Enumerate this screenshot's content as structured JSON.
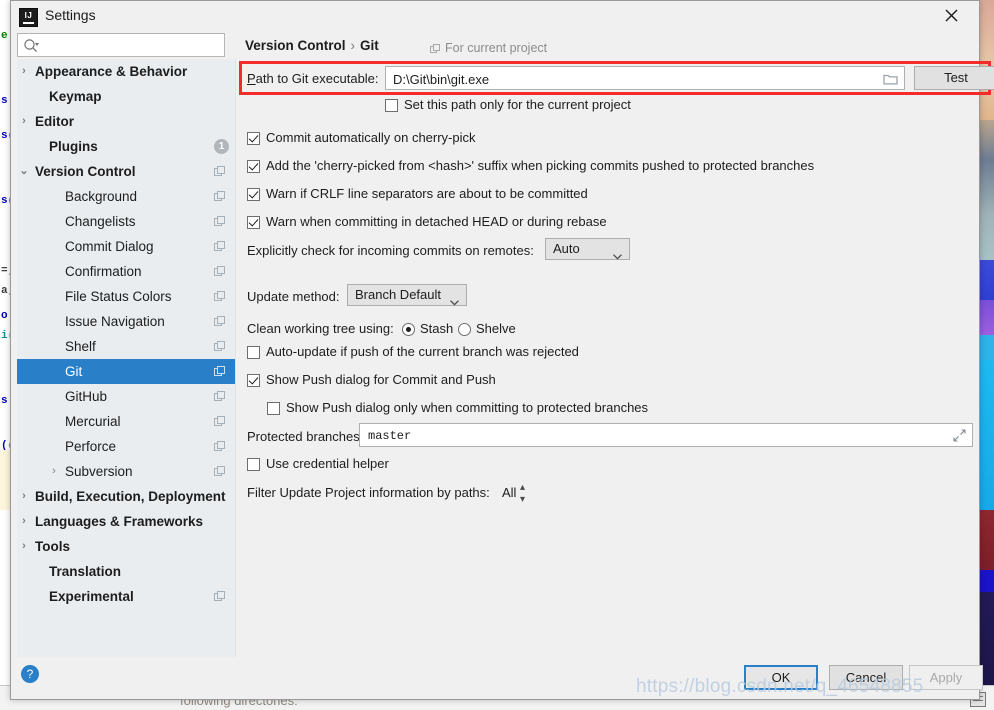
{
  "window": {
    "title": "Settings",
    "logo_text": "IJ",
    "close_icon": "close-icon"
  },
  "search": {
    "value": "",
    "placeholder": "",
    "icon": "search-icon"
  },
  "sidebar": {
    "items": [
      {
        "label": "Appearance & Behavior",
        "indent": 10,
        "twisty": "›",
        "bold": true,
        "copy": false,
        "badge": ""
      },
      {
        "label": "Keymap",
        "indent": 24,
        "twisty": "",
        "bold": true,
        "copy": false,
        "badge": ""
      },
      {
        "label": "Editor",
        "indent": 10,
        "twisty": "›",
        "bold": true,
        "copy": false,
        "badge": ""
      },
      {
        "label": "Plugins",
        "indent": 24,
        "twisty": "",
        "bold": true,
        "copy": false,
        "badge": "1"
      },
      {
        "label": "Version Control",
        "indent": 10,
        "twisty": "⌄",
        "bold": true,
        "copy": true,
        "badge": ""
      },
      {
        "label": "Background",
        "indent": 40,
        "twisty": "",
        "bold": false,
        "copy": true,
        "badge": ""
      },
      {
        "label": "Changelists",
        "indent": 40,
        "twisty": "",
        "bold": false,
        "copy": true,
        "badge": ""
      },
      {
        "label": "Commit Dialog",
        "indent": 40,
        "twisty": "",
        "bold": false,
        "copy": true,
        "badge": ""
      },
      {
        "label": "Confirmation",
        "indent": 40,
        "twisty": "",
        "bold": false,
        "copy": true,
        "badge": ""
      },
      {
        "label": "File Status Colors",
        "indent": 40,
        "twisty": "",
        "bold": false,
        "copy": true,
        "badge": ""
      },
      {
        "label": "Issue Navigation",
        "indent": 40,
        "twisty": "",
        "bold": false,
        "copy": true,
        "badge": ""
      },
      {
        "label": "Shelf",
        "indent": 40,
        "twisty": "",
        "bold": false,
        "copy": true,
        "badge": ""
      },
      {
        "label": "Git",
        "indent": 40,
        "twisty": "",
        "bold": false,
        "copy": true,
        "badge": "",
        "selected": true
      },
      {
        "label": "GitHub",
        "indent": 40,
        "twisty": "",
        "bold": false,
        "copy": true,
        "badge": ""
      },
      {
        "label": "Mercurial",
        "indent": 40,
        "twisty": "",
        "bold": false,
        "copy": true,
        "badge": ""
      },
      {
        "label": "Perforce",
        "indent": 40,
        "twisty": "",
        "bold": false,
        "copy": true,
        "badge": ""
      },
      {
        "label": "Subversion",
        "indent": 40,
        "twisty": "›",
        "bold": false,
        "copy": true,
        "badge": ""
      },
      {
        "label": "Build, Execution, Deployment",
        "indent": 10,
        "twisty": "›",
        "bold": true,
        "copy": false,
        "badge": ""
      },
      {
        "label": "Languages & Frameworks",
        "indent": 10,
        "twisty": "›",
        "bold": true,
        "copy": false,
        "badge": ""
      },
      {
        "label": "Tools",
        "indent": 10,
        "twisty": "›",
        "bold": true,
        "copy": false,
        "badge": ""
      },
      {
        "label": "Translation",
        "indent": 24,
        "twisty": "",
        "bold": true,
        "copy": false,
        "badge": ""
      },
      {
        "label": "Experimental",
        "indent": 24,
        "twisty": "",
        "bold": true,
        "copy": true,
        "badge": ""
      }
    ]
  },
  "breadcrumb": {
    "root": "Version Control",
    "separator": "›",
    "current": "Git",
    "scope_note": "For current project"
  },
  "git": {
    "path_label_pre": "P",
    "path_label_rest": "ath to Git executable:",
    "path_value": "D:\\Git\\bin\\git.exe",
    "browse_icon": "folder-icon",
    "test_button": "Test",
    "set_path_current_project": "Set this path only for the current project",
    "set_path_current_project_checked": false,
    "commit_auto_cherry_pick": "Commit automatically on cherry-pick",
    "commit_auto_cherry_pick_checked": true,
    "add_suffix": "Add the 'cherry-picked from <hash>' suffix when picking commits pushed to protected branches",
    "add_suffix_checked": true,
    "warn_crlf": "Warn if CRLF line separators are about to be committed",
    "warn_crlf_checked": true,
    "warn_detached": "Warn when committing in detached HEAD or during rebase",
    "warn_detached_checked": true,
    "incoming_label": "Explicitly check for incoming commits on remotes:",
    "incoming_value": "Auto",
    "update_method_label": "Update method:",
    "update_method_value": "Branch Default",
    "clean_tree_label": "Clean working tree using:",
    "clean_tree_stash": "Stash",
    "clean_tree_shelve": "Shelve",
    "clean_tree_selected": "Stash",
    "auto_update_rejected": "Auto-update if push of the current branch was rejected",
    "auto_update_rejected_checked": false,
    "show_push_dialog": "Show Push dialog for Commit and Push",
    "show_push_dialog_checked": true,
    "show_push_protected": "Show Push dialog only when committing to protected branches",
    "show_push_protected_checked": false,
    "protected_branches_label": "Protected branches:",
    "protected_branches_value": "master",
    "expand_icon": "expand-icon",
    "use_credential_helper": "Use credential helper",
    "use_credential_helper_checked": false,
    "filter_paths_label": "Filter Update Project information by paths:",
    "filter_paths_value": "All"
  },
  "footer": {
    "help": "?",
    "ok": "OK",
    "cancel": "Cancel",
    "apply": "Apply"
  },
  "watermark": "https://blog.csdn.net/q_46548855",
  "background": {
    "bottom_text": "following directories:",
    "code_fragments": [
      "e:",
      "s:",
      "s(",
      "s(",
      "=;",
      "a;",
      "o:",
      "i(",
      "s:",
      "(("
    ]
  },
  "colors": {
    "accent": "#2a7fc9",
    "selection": "#2a7fc9",
    "highlight_box": "#f42b2b",
    "sidebar_bg": "#e9edf0",
    "panel_bg": "#f0f0f0"
  }
}
